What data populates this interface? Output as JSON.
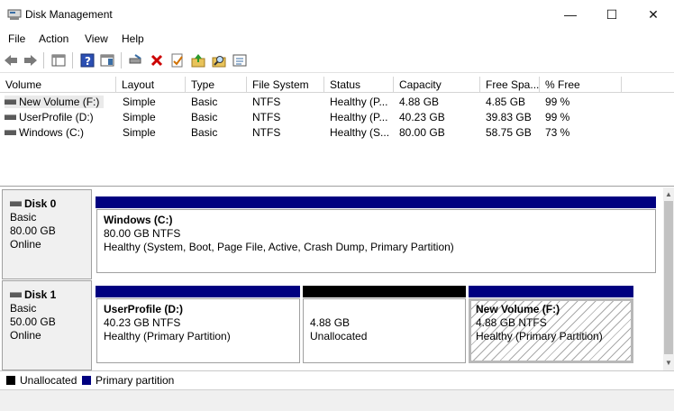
{
  "window": {
    "title": "Disk Management",
    "minimize": "—",
    "maximize": "☐",
    "close": "✕"
  },
  "menu": [
    "File",
    "Action",
    "View",
    "Help"
  ],
  "volume_list": {
    "headers": [
      "Volume",
      "Layout",
      "Type",
      "File System",
      "Status",
      "Capacity",
      "Free Spa...",
      "% Free"
    ],
    "rows": [
      [
        "New Volume (F:)",
        "Simple",
        "Basic",
        "NTFS",
        "Healthy (P...",
        "4.88 GB",
        "4.85 GB",
        "99 %"
      ],
      [
        "UserProfile (D:)",
        "Simple",
        "Basic",
        "NTFS",
        "Healthy (P...",
        "40.23 GB",
        "39.83 GB",
        "99 %"
      ],
      [
        "Windows (C:)",
        "Simple",
        "Basic",
        "NTFS",
        "Healthy (S...",
        "80.00 GB",
        "58.75 GB",
        "73 %"
      ]
    ]
  },
  "disks": [
    {
      "name": "Disk 0",
      "type": "Basic",
      "size": "80.00 GB",
      "state": "Online",
      "partitions": [
        {
          "title": "Windows  (C:)",
          "size": "80.00 GB NTFS",
          "status": "Healthy (System, Boot, Page File, Active, Crash Dump, Primary Partition)"
        }
      ]
    },
    {
      "name": "Disk 1",
      "type": "Basic",
      "size": "50.00 GB",
      "state": "Online",
      "partitions": [
        {
          "title": "UserProfile  (D:)",
          "size": "40.23 GB NTFS",
          "status": "Healthy (Primary Partition)"
        },
        {
          "title": "",
          "size": "4.88 GB",
          "status": "Unallocated"
        },
        {
          "title": "New Volume  (F:)",
          "size": "4.88 GB NTFS",
          "status": "Healthy (Primary Partition)"
        }
      ]
    }
  ],
  "legend": [
    {
      "label": "Unallocated",
      "color": "#000000"
    },
    {
      "label": "Primary partition",
      "color": "#000080"
    }
  ],
  "colors": {
    "primary": "#000080",
    "unallocated": "#000000",
    "error": "#cc0000"
  }
}
